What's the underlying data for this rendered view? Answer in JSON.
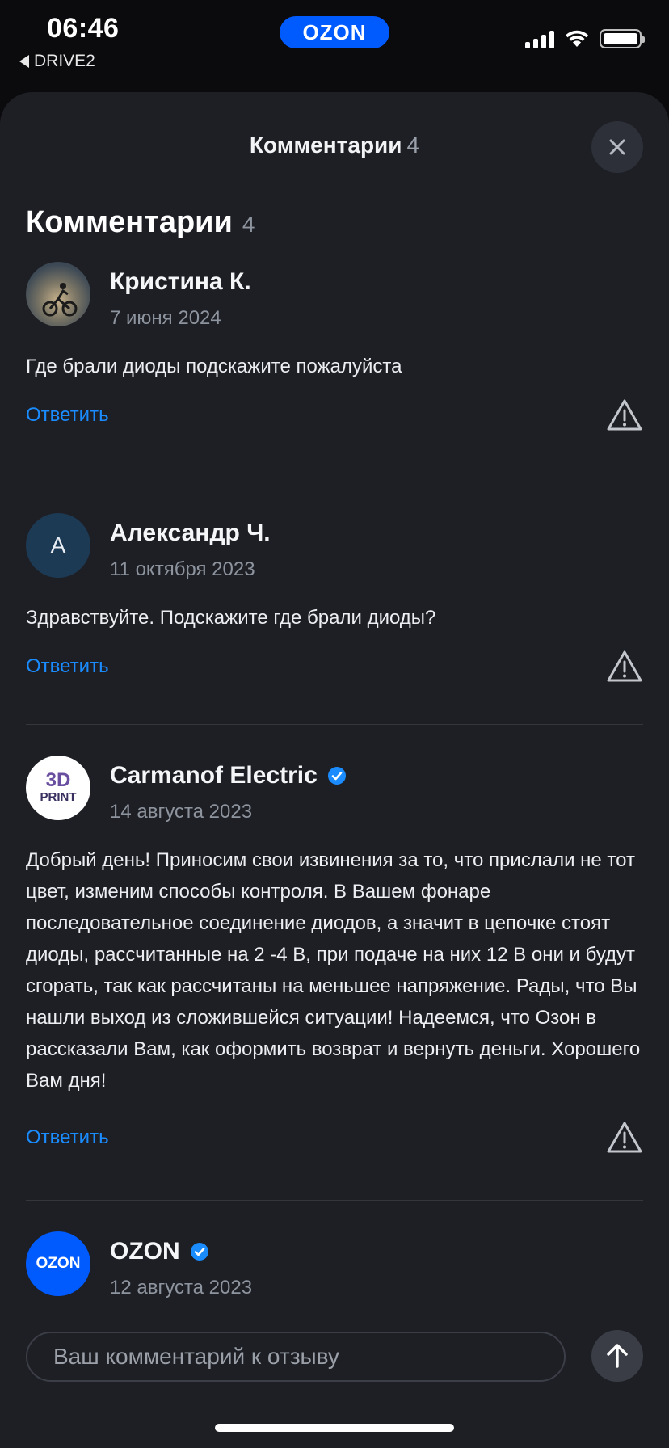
{
  "status": {
    "time": "06:46",
    "back_app": "DRIVE2",
    "center_badge": "OZON"
  },
  "sheet": {
    "title": "Комментарии",
    "title_count": "4",
    "close_icon": "close-icon"
  },
  "section": {
    "title": "Комментарии",
    "count": "4"
  },
  "comments": [
    {
      "author": "Кристина К.",
      "date": "7 июня 2024",
      "text": "Где брали диоды подскажите пожалуйста",
      "reply_label": "Ответить",
      "avatar": "photo",
      "verified": false
    },
    {
      "author": "Александр Ч.",
      "date": "11 октября 2023",
      "text": "Здравствуйте. Подскажите где брали диоды?",
      "reply_label": "Ответить",
      "avatar_letter": "А",
      "verified": false
    },
    {
      "author": "Carmanof Electric",
      "date": "14 августа 2023",
      "text": "Добрый день! Приносим свои извинения за то, что прислали не тот цвет, изменим способы контроля. В Вашем фонаре последовательное соединение диодов, а значит в цепочке стоят диоды, рассчитанные на 2 -4 В, при подаче на них 12 В они и будут сгорать, так как рассчитаны на меньшее напряжение. Рады, что Вы нашли выход из сложившейся ситуации! Надеемся, что Озон в рассказали Вам, как оформить возврат и вернуть деньги. Хорошего Вам дня!",
      "reply_label": "Ответить",
      "avatar_line1": "3D",
      "avatar_line2": "PRINT",
      "verified": true
    },
    {
      "author": "OZON",
      "date": "12 августа 2023",
      "avatar_text": "OZON",
      "verified": true
    }
  ],
  "composer": {
    "placeholder": "Ваш комментарий к отзыву"
  },
  "colors": {
    "accent": "#1a8cff",
    "ozon_blue": "#005bff",
    "sheet_bg": "#1d1f25"
  }
}
